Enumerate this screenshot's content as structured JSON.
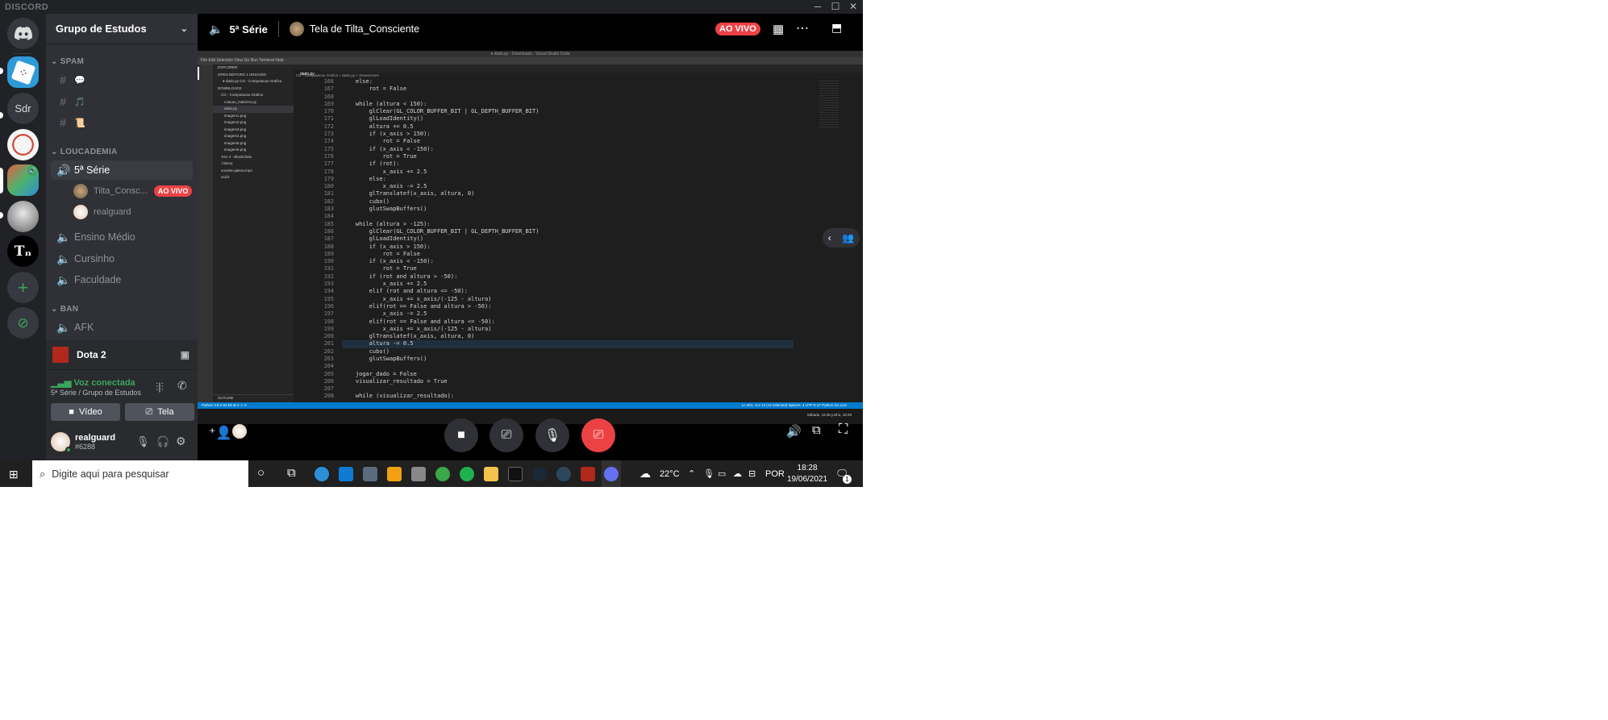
{
  "window": {
    "brand": "DISCORD",
    "controls": [
      "minimize-icon",
      "maximize-icon",
      "close-icon"
    ]
  },
  "guilds": [
    {
      "name": "home",
      "icon": "discord-logo-icon"
    },
    {
      "name": "game",
      "icon": "game-server-icon"
    },
    {
      "name": "sdr",
      "label": "Sdr"
    },
    {
      "name": "server-4"
    },
    {
      "name": "server-5-active"
    },
    {
      "name": "server-6"
    },
    {
      "name": "tin",
      "label": "Tₙ"
    },
    {
      "name": "add",
      "icon": "plus-icon"
    },
    {
      "name": "explore",
      "icon": "compass-icon"
    }
  ],
  "sidebar": {
    "server_name": "Grupo de Estudos",
    "categories": [
      {
        "label": "SPAM"
      },
      {
        "label": "LOUCADEMIA"
      },
      {
        "label": "BAN"
      }
    ],
    "spam_channels": [
      {
        "emoji": "💬"
      },
      {
        "emoji": "🎵"
      },
      {
        "emoji": "📜"
      }
    ],
    "voice_channels": [
      {
        "label": "5ª Série"
      },
      {
        "label": "Ensino Médio"
      },
      {
        "label": "Cursinho"
      },
      {
        "label": "Faculdade"
      }
    ],
    "voice_users": [
      {
        "name": "Tilta_Consc...",
        "badge": "AO VIVO"
      },
      {
        "name": "realguard"
      }
    ],
    "afk_channel": "AFK",
    "activity": "Dota 2",
    "voice_status": "Voz conectada",
    "voice_location": "5ª Série / Grupo de Estudos",
    "video_button": "Vídeo",
    "screen_button": "Tela",
    "user": {
      "name": "realguard",
      "tag": "#6288"
    }
  },
  "stream": {
    "channel": "5ª Série",
    "title": "Tela de Tilta_Consciente",
    "live_badge": "AO VIVO"
  },
  "vscode": {
    "title": "● dado.py - Downloads - Visual Studio Code",
    "menu": "File   Edit   Selection   View   Go   Run   Terminal   Help",
    "tab": "dado.py",
    "breadcrumb": "CG - Computacao Grafica  >  dado.py  >  showScreen",
    "explorer": [
      "EXPLORER",
      "OPEN EDITORS   1 UNSAVED",
      "● dado.py  CG - Computacao Grafica",
      "DOWNLOADS",
      "CG - Computacao Grafica",
      "criacao_matrizes.py",
      "dado.py",
      "imagem1.png",
      "imagem2.png",
      "imagem3.png",
      "imagem4.png",
      "imagem5.png",
      "imagem6.png",
      "TAC 2 - Blockchain",
      ".history",
      "sorvete-galera.mp4",
      "vsd.lt"
    ],
    "line_numbers": [
      "166",
      "167",
      "168",
      "169",
      "170",
      "171",
      "172",
      "173",
      "174",
      "175",
      "176",
      "177",
      "178",
      "179",
      "180",
      "181",
      "182",
      "183",
      "184",
      "185",
      "186",
      "187",
      "188",
      "189",
      "190",
      "191",
      "192",
      "193",
      "194",
      "195",
      "196",
      "197",
      "198",
      "199",
      "200",
      "201",
      "202",
      "203",
      "204",
      "205",
      "206",
      "207",
      "208"
    ],
    "code_lines": [
      "    else:",
      "        rot = False",
      "",
      "    while (altura < 150):",
      "        glClear(GL_COLOR_BUFFER_BIT | GL_DEPTH_BUFFER_BIT)",
      "        glLoadIdentity()",
      "        altura += 0.5",
      "        if (x_axis > 150):",
      "            rot = False",
      "        if (x_axis < -150):",
      "            rot = True",
      "        if (rot):",
      "            x_axis += 2.5",
      "        else:",
      "            x_axis -= 2.5",
      "        glTranslatef(x_axis, altura, 0)",
      "        cubo()",
      "        glutSwapBuffers()",
      "",
      "    while (altura > -125):",
      "        glClear(GL_COLOR_BUFFER_BIT | GL_DEPTH_BUFFER_BIT)",
      "        glLoadIdentity()",
      "        if (x_axis > 150):",
      "            rot = False",
      "        if (x_axis < -150):",
      "            rot = True",
      "        if (rot and altura > -50):",
      "            x_axis += 2.5",
      "        elif (rot and altura <= -50):",
      "            x_axis += x_axis/(-125 - altura)",
      "        elif(rot == False and altura > -50):",
      "            x_axis -= 2.5",
      "        elif(rot == False and altura <= -50):",
      "            x_axis += x_axis/(-125 - altura)",
      "        glTranslatef(x_axis, altura, 0)",
      "        altura -= 0.5",
      "        cubo()",
      "        glutSwapBuffers()",
      "",
      "    jogar_dado = False",
      "    visualizar_resultado = True",
      "",
      "    while (visualizar_resultado):"
    ],
    "status_left": "Python 3.9.2 64-bit   ⊗ 0 ⚠ 0",
    "status_right": "Ln 201, Col 13 (13 selected)   Spaces: 4   UTF-8   LF   Python   Go Live",
    "outline": "OUTLINE",
    "clock_small": "Sábado, 19 de junho, 18:28"
  },
  "windows_taskbar": {
    "search_placeholder": "Digite aqui para pesquisar",
    "temperature": "22°C",
    "language": "POR",
    "time": "18:28",
    "date": "19/06/2021",
    "notification_count": "1"
  },
  "colors": {
    "discord_bg": "#202225",
    "sidebar": "#2f3136",
    "live_red": "#ed4245",
    "vscode_blue": "#007acc",
    "voice_green": "#3ba55d",
    "blurple": "#5865f2"
  }
}
